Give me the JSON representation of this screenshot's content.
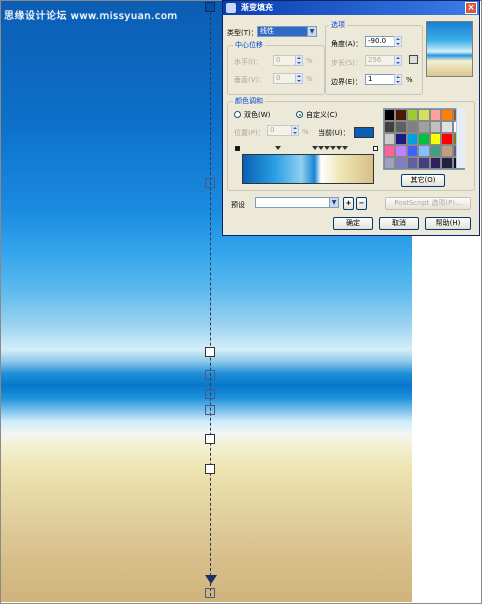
{
  "watermark": "思缘设计论坛 www.missyuan.com",
  "dialog": {
    "title": "渐变填充",
    "close_glyph": "×",
    "type_label": "类型(T)：",
    "type_value": "线性",
    "center_offset": {
      "title": "中心位移",
      "horizontal_label": "水平(I)：",
      "horizontal_value": "0",
      "vertical_label": "垂直(V)：",
      "vertical_value": "0",
      "unit": "%"
    },
    "options": {
      "title": "选项",
      "angle_label": "角度(A)：",
      "angle_value": "-90.0",
      "steps_label": "步长(S)：",
      "steps_value": "256",
      "edge_pad_label": "边界(E)：",
      "edge_pad_value": "1",
      "unit": "%"
    },
    "color_blend": {
      "title": "颜色调和",
      "two_color_label": "双色(W)",
      "custom_label": "自定义(C)",
      "position_label": "位置(P)：",
      "position_value": "0",
      "position_unit": "%",
      "current_label": "当前(U)：",
      "current_color": "#0a5fb5",
      "others_button": "其它(O)"
    },
    "palette": [
      "#000000",
      "#4d1a00",
      "#9acd32",
      "#d0e060",
      "#ffa0a0",
      "#ff8000",
      "#a05030",
      "#404040",
      "#606060",
      "#808080",
      "#a0a0a0",
      "#c0c0c0",
      "#e0e0e0",
      "#ffffff",
      "#cccccc",
      "#1a1a80",
      "#00a0e0",
      "#00c040",
      "#ffff00",
      "#ff0000",
      "#808000",
      "#ff60a0",
      "#c080ff",
      "#4060ff",
      "#80c0ff",
      "#40a080",
      "#c0a080",
      "#606080",
      "#a0a0c0",
      "#8080c0",
      "#6060a0",
      "#404080",
      "#302060",
      "#202040",
      "#101020"
    ],
    "preset_label": "预设",
    "postscript_button": "PostScript 选项(P)...",
    "ok_button": "确定",
    "cancel_button": "取消",
    "help_button": "帮助(H)"
  }
}
